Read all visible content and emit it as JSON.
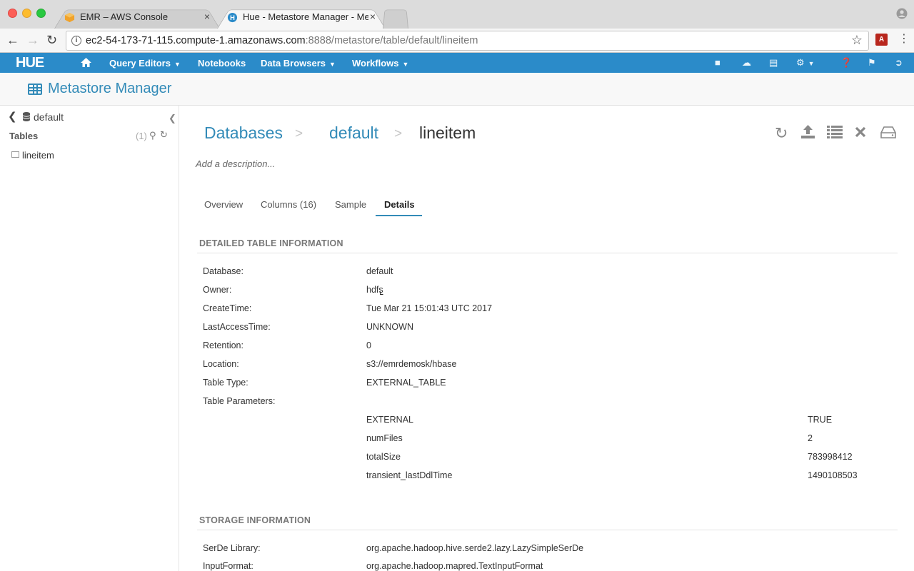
{
  "browser": {
    "tabs": [
      {
        "label": "EMR – AWS Console",
        "close": "×"
      },
      {
        "label": "Hue - Metastore Manager - Me",
        "close": "×"
      }
    ],
    "url_host": "ec2-54-173-71-115.compute-1.amazonaws.com",
    "url_path": ":8888/metastore/table/default/lineitem"
  },
  "hue": {
    "logo": "HUE",
    "nav": {
      "query_editors": "Query Editors",
      "notebooks": "Notebooks",
      "data_browsers": "Data Browsers",
      "workflows": "Workflows"
    }
  },
  "app": {
    "title": "Metastore Manager"
  },
  "left_panel": {
    "database": "default",
    "tables_heading": "Tables",
    "count": "(1)",
    "items": [
      "lineitem"
    ]
  },
  "breadcrumb": {
    "databases": "Databases",
    "sep": ">",
    "database": "default",
    "table": "lineitem"
  },
  "description_placeholder": "Add a description...",
  "tabs": {
    "overview": "Overview",
    "columns": "Columns (16)",
    "sample": "Sample",
    "details": "Details"
  },
  "detailed": {
    "title": "DETAILED TABLE INFORMATION",
    "rows": [
      {
        "label": "Database:",
        "value": "default"
      },
      {
        "label": "Owner:",
        "value": "hdfs"
      },
      {
        "label": "CreateTime:",
        "value": "Tue Mar 21 15:01:43 UTC 2017"
      },
      {
        "label": "LastAccessTime:",
        "value": "UNKNOWN"
      },
      {
        "label": "Retention:",
        "value": "0"
      },
      {
        "label": "Location:",
        "value": "s3://emrdemosk/hbase"
      },
      {
        "label": "Table Type:",
        "value": "EXTERNAL_TABLE"
      },
      {
        "label": "Table Parameters:",
        "value": ""
      }
    ],
    "params": [
      {
        "key": "EXTERNAL",
        "value": "TRUE"
      },
      {
        "key": "numFiles",
        "value": "2"
      },
      {
        "key": "totalSize",
        "value": "783998412"
      },
      {
        "key": "transient_lastDdlTime",
        "value": "1490108503"
      }
    ]
  },
  "storage": {
    "title": "STORAGE INFORMATION",
    "rows": [
      {
        "label": "SerDe Library:",
        "value": "org.apache.hadoop.hive.serde2.lazy.LazySimpleSerDe"
      },
      {
        "label": "InputFormat:",
        "value": "org.apache.hadoop.mapred.TextInputFormat"
      }
    ]
  },
  "colors": {
    "hue_blue": "#2b8bc9",
    "link_blue": "#338bb8"
  }
}
